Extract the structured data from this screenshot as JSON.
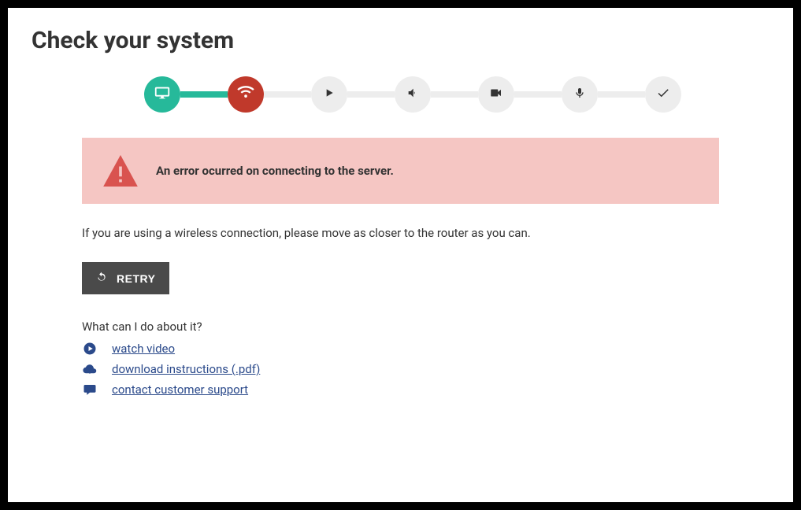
{
  "title": "Check your system",
  "steps": [
    {
      "name": "monitor",
      "state": "complete"
    },
    {
      "name": "wifi",
      "state": "error"
    },
    {
      "name": "play",
      "state": "pending"
    },
    {
      "name": "volume",
      "state": "pending"
    },
    {
      "name": "video",
      "state": "pending"
    },
    {
      "name": "microphone",
      "state": "pending"
    },
    {
      "name": "check",
      "state": "pending"
    }
  ],
  "alert": {
    "message": "An error ocurred on connecting to the server."
  },
  "instruction": "If you are using a wireless connection, please move as closer to the router as you can.",
  "retry_label": "RETRY",
  "help": {
    "title": "What can I do about it?",
    "items": [
      {
        "icon": "play-circle",
        "label": "watch video"
      },
      {
        "icon": "cloud-download",
        "label": "download instructions (.pdf)"
      },
      {
        "icon": "chat",
        "label": "contact customer support"
      }
    ]
  },
  "colors": {
    "complete": "#26b99a",
    "error": "#c0392b",
    "pending_bg": "#ededed",
    "alert_bg": "#f5c6c3",
    "alert_icon": "#d9534f",
    "retry_bg": "#4a4a4a",
    "link": "#2b4a8b"
  }
}
